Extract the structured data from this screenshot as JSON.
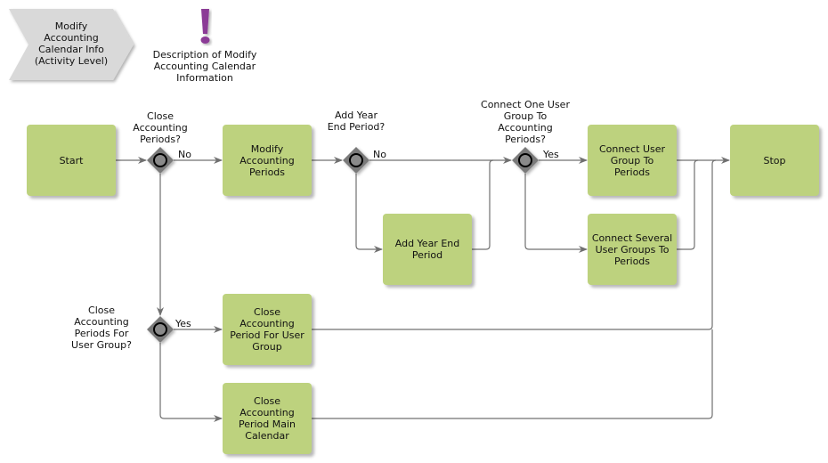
{
  "header": {
    "activity_chevron": "Modify Accounting Calendar Info (Activity Level)",
    "description_note": "Description of Modify Accounting Calendar Information",
    "note_icon": "exclamation-icon"
  },
  "colors": {
    "task_fill": "#bdd27e",
    "gateway_fill": "#7a7a7a",
    "connector": "#707070",
    "chevron_fill": "#d9d9d9",
    "note_accent": "#8b3a96"
  },
  "nodes": {
    "start": "Start",
    "modify_periods": "Modify Accounting Periods",
    "add_year_end": "Add Year End Period",
    "connect_one": "Connect User Group To Periods",
    "connect_several": "Connect Several User Groups To Periods",
    "close_user_group": "Close Accounting Period For User Group",
    "close_main": "Close Accounting Period Main Calendar",
    "stop": "Stop"
  },
  "gateways": {
    "g1": "Close Accounting Periods?",
    "g2": "Add Year End Period?",
    "g3": "Connect One User Group To Accounting Periods?",
    "g4": "Close Accounting Periods For User Group?"
  },
  "edge_labels": {
    "g1_no": "No",
    "g2_no": "No",
    "g3_yes": "Yes",
    "g4_yes": "Yes"
  }
}
